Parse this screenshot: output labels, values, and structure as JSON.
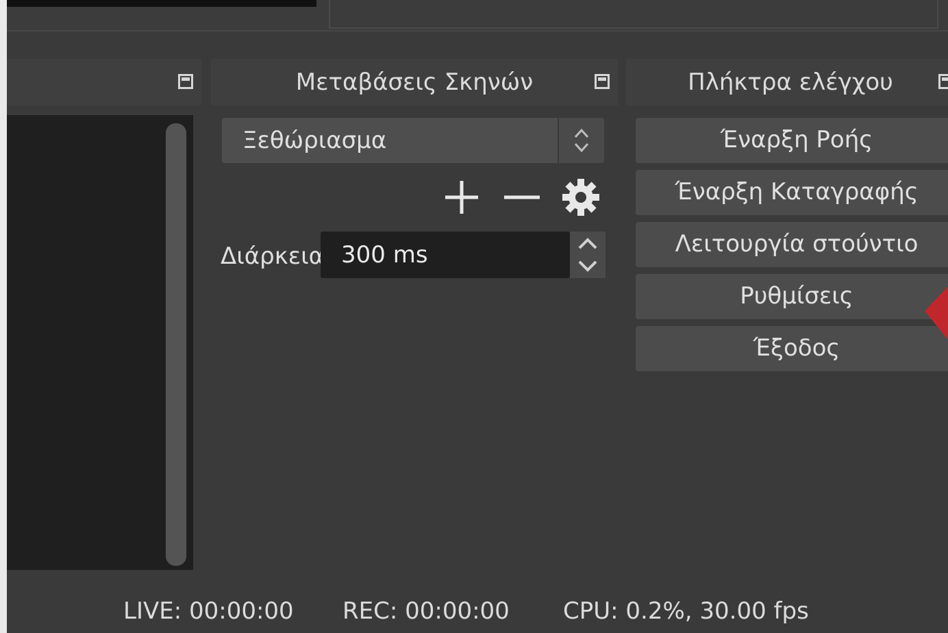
{
  "scenes_dock": {
    "title": ""
  },
  "transitions_dock": {
    "title": "Μεταβάσεις Σκηνών",
    "transition_select": "Ξεθώριασμα",
    "add_button": "+",
    "remove_button": "—",
    "duration_label": "Διάρκεια",
    "duration_value": "300 ms"
  },
  "controls_dock": {
    "title": "Πλήκτρα ελέγχου",
    "buttons": [
      {
        "label": "Έναρξη Ροής"
      },
      {
        "label": "Έναρξη Καταγραφής"
      },
      {
        "label": "Λειτουργία στούντιο"
      },
      {
        "label": "Ρυθμίσεις"
      },
      {
        "label": "Έξοδος"
      }
    ]
  },
  "statusbar": {
    "live": "LIVE: 00:00:00",
    "rec": "REC: 00:00:00",
    "cpu": "CPU: 0.2%, 30.00 fps"
  },
  "colors": {
    "panel": "#3a3a3a",
    "button": "#4c4c4c",
    "list_bg": "#1f1f1f",
    "highlight_arrow": "#c0272d"
  },
  "icons": [
    "float-dock-icon",
    "settings-gear-icon",
    "spinner-arrows-icon",
    "red-pointer-arrow-icon"
  ]
}
